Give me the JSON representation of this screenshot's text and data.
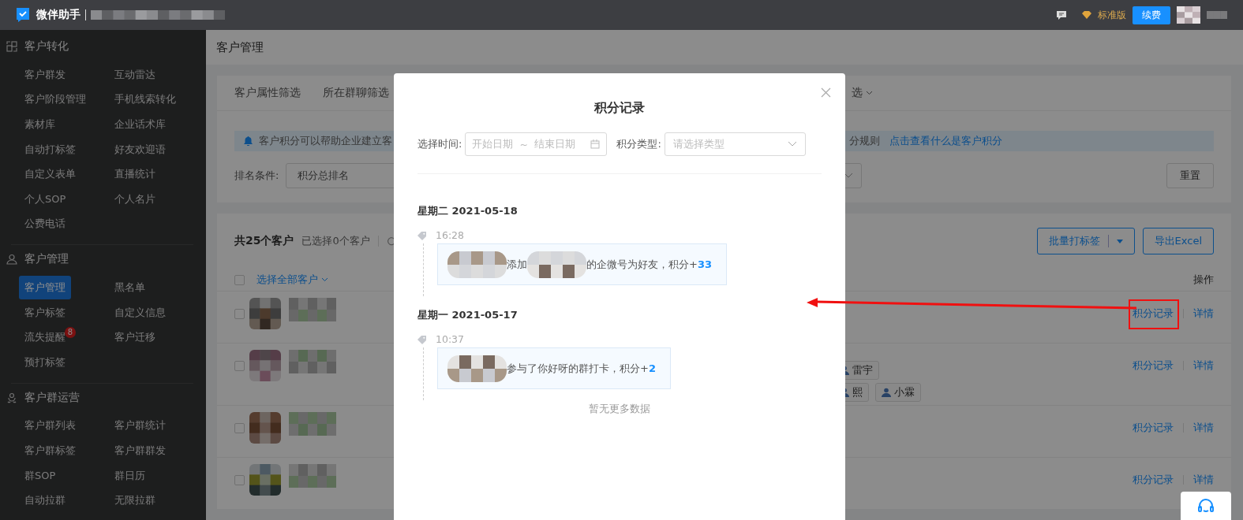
{
  "topbar": {
    "app_name": "微伴助手",
    "edition": "标准版",
    "renew_button": "续费"
  },
  "sidebar": {
    "sections": [
      {
        "kind": "conversion",
        "title": "客户转化",
        "items": [
          {
            "label": "客户群发",
            "selected": false
          },
          {
            "label": "互动雷达",
            "selected": false
          },
          {
            "label": "客户阶段管理",
            "selected": false
          },
          {
            "label": "手机线索转化",
            "selected": false
          },
          {
            "label": "素材库",
            "selected": false
          },
          {
            "label": "企业话术库",
            "selected": false
          },
          {
            "label": "自动打标签",
            "selected": false
          },
          {
            "label": "好友欢迎语",
            "selected": false
          },
          {
            "label": "自定义表单",
            "selected": false
          },
          {
            "label": "直播统计",
            "selected": false
          },
          {
            "label": "个人SOP",
            "selected": false
          },
          {
            "label": "个人名片",
            "selected": false
          },
          {
            "label": "公费电话",
            "selected": false
          }
        ]
      },
      {
        "kind": "customer",
        "title": "客户管理",
        "items": [
          {
            "label": "客户管理",
            "selected": true
          },
          {
            "label": "黑名单",
            "selected": false
          },
          {
            "label": "客户标签",
            "selected": false
          },
          {
            "label": "自定义信息",
            "selected": false
          },
          {
            "label": "流失提醒",
            "selected": false,
            "badge": "8"
          },
          {
            "label": "客户迁移",
            "selected": false
          },
          {
            "label": "预打标签",
            "selected": false
          }
        ]
      },
      {
        "kind": "group",
        "title": "客户群运营",
        "items": [
          {
            "label": "客户群列表",
            "selected": false
          },
          {
            "label": "客户群统计",
            "selected": false
          },
          {
            "label": "客户群标签",
            "selected": false
          },
          {
            "label": "客户群群发",
            "selected": false
          },
          {
            "label": "群SOP",
            "selected": false
          },
          {
            "label": "群日历",
            "selected": false
          },
          {
            "label": "自动拉群",
            "selected": false
          },
          {
            "label": "无限拉群",
            "selected": false
          }
        ]
      }
    ]
  },
  "page_title": "客户管理",
  "filter_card": {
    "tabs": [
      {
        "label": "客户属性筛选",
        "kind": "plain"
      },
      {
        "label": "所在群聊筛选",
        "kind": "plain"
      },
      {
        "label": "选",
        "kind": "dropdown"
      }
    ],
    "notice": {
      "text": "客户积分可以帮助企业建立客",
      "rule_text": "分规则",
      "link": "点击查看什么是客户积分"
    },
    "sort": {
      "label": "排名条件:",
      "value": "积分总排名"
    },
    "reset_button": "重置"
  },
  "customers": {
    "total": "共25个客户",
    "selected_count": "已选择0个客户",
    "batch_tag_button": "批量打标签",
    "export_button": "导出Excel",
    "select_all": "选择全部客户",
    "select_all_checked": false,
    "action_header": "操作",
    "rows": [
      {
        "checked": false,
        "tags": [],
        "actions": [
          "积分记录",
          "详情"
        ]
      },
      {
        "checked": false,
        "tags": [
          [
            "雷宇"
          ],
          [
            "熙",
            "小霖"
          ]
        ],
        "actions": [
          "积分记录",
          "详情"
        ]
      },
      {
        "checked": false,
        "tags": [],
        "actions": [
          "积分记录",
          "详情"
        ]
      },
      {
        "checked": false,
        "tags": [],
        "actions": [
          "积分记录",
          "详情"
        ]
      }
    ]
  },
  "modal": {
    "title": "积分记录",
    "time_label": "选择时间:",
    "start_placeholder": "开始日期",
    "separator": "~",
    "end_placeholder": "结束日期",
    "type_label": "积分类型:",
    "type_placeholder": "请选择类型",
    "days": [
      {
        "date": "星期二 2021-05-18",
        "records": [
          {
            "time": "16:28",
            "parts": [
              {
                "kind": "picture"
              },
              {
                "kind": "text",
                "text": "添加"
              },
              {
                "kind": "picture"
              },
              {
                "kind": "text",
                "text": "的企微号为好友，积分+"
              }
            ],
            "points": "33"
          }
        ]
      },
      {
        "date": "星期一 2021-05-17",
        "records": [
          {
            "time": "10:37",
            "parts": [
              {
                "kind": "picture"
              },
              {
                "kind": "text",
                "text": "参与了你好呀的群打卡，积分+"
              }
            ],
            "points": "2"
          }
        ]
      }
    ],
    "footer": "暂无更多数据"
  }
}
